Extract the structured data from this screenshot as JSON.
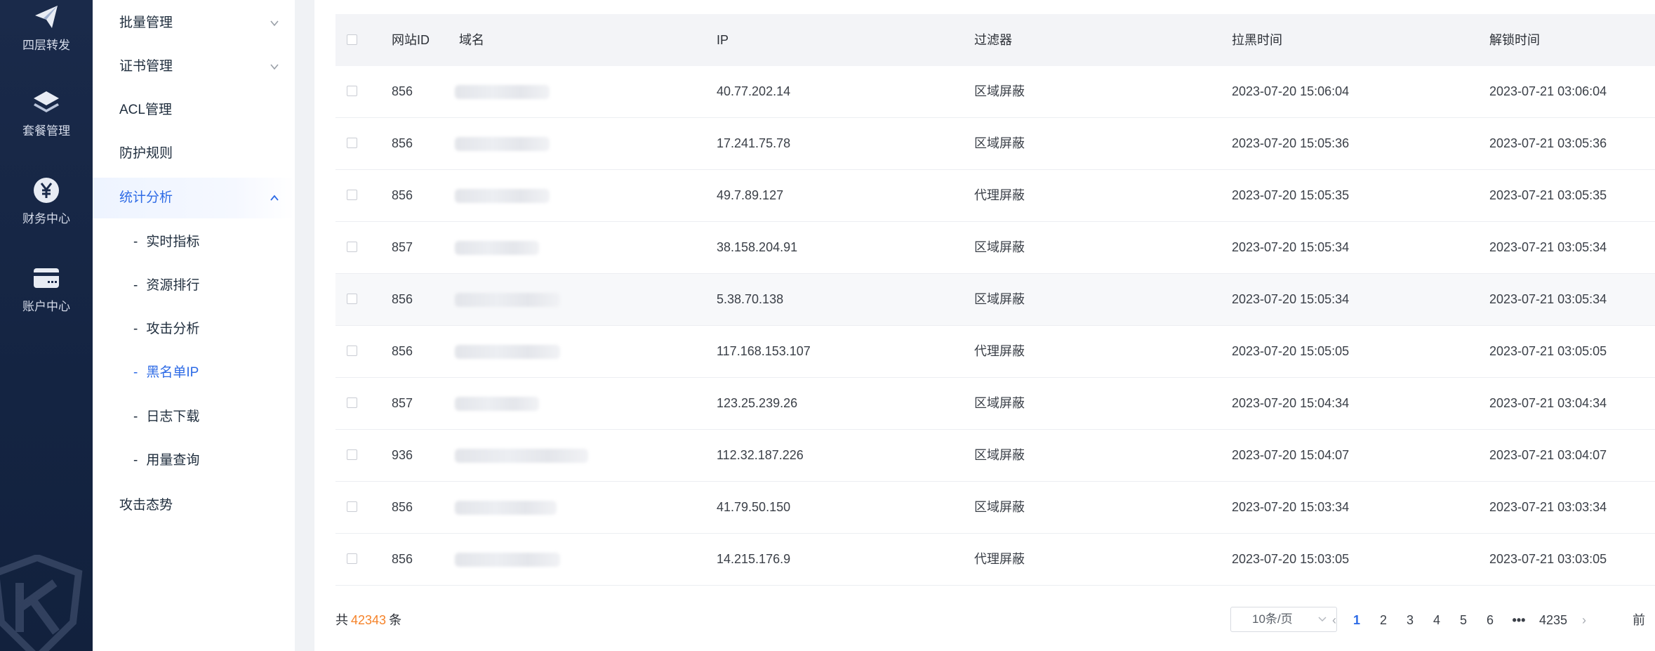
{
  "rail": {
    "items": [
      {
        "label": "四层转发",
        "icon": "paper-plane-icon"
      },
      {
        "label": "套餐管理",
        "icon": "layers-icon"
      },
      {
        "label": "财务中心",
        "icon": "yen-coin-icon"
      },
      {
        "label": "账户中心",
        "icon": "card-icon"
      }
    ]
  },
  "submenu": {
    "items": [
      {
        "label": "批量管理",
        "expandable": true
      },
      {
        "label": "证书管理",
        "expandable": true
      },
      {
        "label": "ACL管理"
      },
      {
        "label": "防护规则"
      },
      {
        "label": "统计分析",
        "expanded": true,
        "active": true
      }
    ],
    "children": [
      {
        "label": "实时指标"
      },
      {
        "label": "资源排行"
      },
      {
        "label": "攻击分析"
      },
      {
        "label": "黑名单IP",
        "active": true
      },
      {
        "label": "日志下载"
      },
      {
        "label": "用量查询"
      }
    ],
    "last": {
      "label": "攻击态势"
    },
    "dash": "-"
  },
  "table": {
    "columns": [
      "网站ID",
      "域名",
      "IP",
      "过滤器",
      "拉黑时间",
      "解锁时间"
    ],
    "rows": [
      {
        "site_id": "856",
        "domain_text": "",
        "ip": "40.77.202.14",
        "filter": "区域屏蔽",
        "blocked": "2023-07-20 15:06:04",
        "unlock": "2023-07-21 03:06:04"
      },
      {
        "site_id": "856",
        "domain_text": "",
        "ip": "17.241.75.78",
        "filter": "区域屏蔽",
        "blocked": "2023-07-20 15:05:36",
        "unlock": "2023-07-21 03:05:36"
      },
      {
        "site_id": "856",
        "domain_text": "",
        "ip": "49.7.89.127",
        "filter": "代理屏蔽",
        "blocked": "2023-07-20 15:05:35",
        "unlock": "2023-07-21 03:05:35"
      },
      {
        "site_id": "857",
        "domain_text": "",
        "ip": "38.158.204.91",
        "filter": "区域屏蔽",
        "blocked": "2023-07-20 15:05:34",
        "unlock": "2023-07-21 03:05:34"
      },
      {
        "site_id": "856",
        "domain_text": "",
        "ip": "5.38.70.138",
        "filter": "区域屏蔽",
        "blocked": "2023-07-20 15:05:34",
        "unlock": "2023-07-21 03:05:34"
      },
      {
        "site_id": "856",
        "domain_text": "",
        "ip": "117.168.153.107",
        "filter": "代理屏蔽",
        "blocked": "2023-07-20 15:05:05",
        "unlock": "2023-07-21 03:05:05"
      },
      {
        "site_id": "857",
        "domain_text": "",
        "ip": "123.25.239.26",
        "filter": "区域屏蔽",
        "blocked": "2023-07-20 15:04:34",
        "unlock": "2023-07-21 03:04:34"
      },
      {
        "site_id": "936",
        "domain_text": "",
        "ip": "112.32.187.226",
        "filter": "区域屏蔽",
        "blocked": "2023-07-20 15:04:07",
        "unlock": "2023-07-21 03:04:07"
      },
      {
        "site_id": "856",
        "domain_text": "w",
        "ip": "41.79.50.150",
        "filter": "区域屏蔽",
        "blocked": "2023-07-20 15:03:34",
        "unlock": "2023-07-21 03:03:34"
      },
      {
        "site_id": "856",
        "domain_text": "",
        "ip": "14.215.176.9",
        "filter": "代理屏蔽",
        "blocked": "2023-07-20 15:03:05",
        "unlock": "2023-07-21 03:03:05"
      }
    ]
  },
  "footer": {
    "total_prefix": "共",
    "total_count": "42343",
    "total_suffix": "条",
    "page_size": "10条/页",
    "prev_arrow": "‹",
    "next_arrow": "›",
    "pages": [
      "1",
      "2",
      "3",
      "4",
      "5",
      "6",
      "•••",
      "4235"
    ],
    "current_page": "1",
    "goto_label": "前"
  },
  "colors": {
    "accent": "#2e6be6",
    "count": "#f5832a",
    "rail_bg": "#1a2a4a"
  }
}
